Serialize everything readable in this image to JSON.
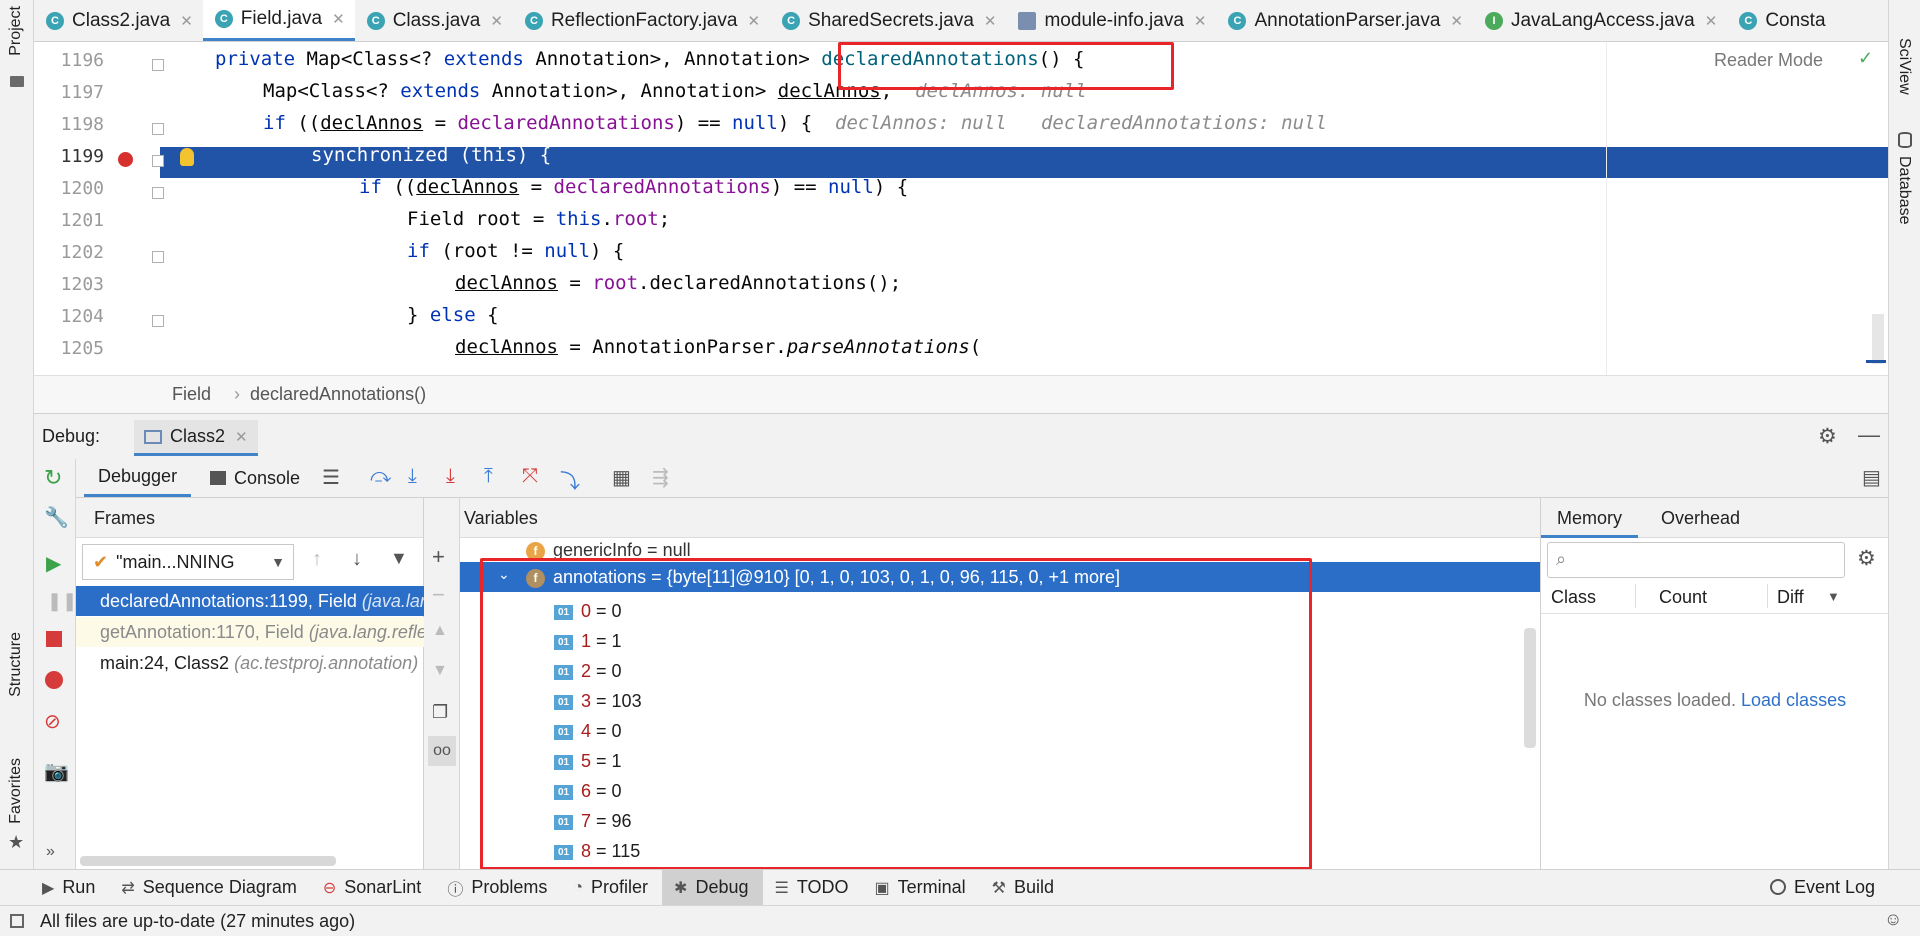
{
  "tabs": [
    {
      "label": "Class2.java",
      "icon": "class-icon",
      "active": false
    },
    {
      "label": "Field.java",
      "icon": "class-icon",
      "active": true
    },
    {
      "label": "Class.java",
      "icon": "class-icon",
      "active": false
    },
    {
      "label": "ReflectionFactory.java",
      "icon": "class-icon",
      "active": false
    },
    {
      "label": "SharedSecrets.java",
      "icon": "class-icon",
      "active": false
    },
    {
      "label": "module-info.java",
      "icon": "module-icon",
      "active": false
    },
    {
      "label": "AnnotationParser.java",
      "icon": "class-icon",
      "active": false
    },
    {
      "label": "JavaLangAccess.java",
      "icon": "interface-icon",
      "active": false
    },
    {
      "label": "Consta",
      "icon": "class-icon",
      "active": false
    }
  ],
  "side_left": {
    "project": "Project",
    "structure": "Structure",
    "favorites": "Favorites"
  },
  "side_right": {
    "sciview": "SciView",
    "database": "Database"
  },
  "editor": {
    "reader_mode": "Reader Mode",
    "line_numbers": [
      "1196",
      "1197",
      "1198",
      "1199",
      "1200",
      "1201",
      "1202",
      "1203",
      "1204",
      "1205"
    ],
    "hints": {
      "l1197": "declAnnos: null",
      "l1198a": "declAnnos: null",
      "l1198b": "declaredAnnotations: null"
    }
  },
  "breadcrumb": {
    "item1": "Field",
    "sep": "›",
    "item2": "declaredAnnotations()"
  },
  "debug": {
    "title": "Debug:",
    "session": "Class2",
    "tab_debugger": "Debugger",
    "tab_console": "Console",
    "frames_header": "Frames",
    "thread_select": "\"main...NNING",
    "frames": [
      {
        "method": "declaredAnnotations:1199, Field",
        "loc": "(java.lang.reflect)",
        "selected": true
      },
      {
        "method": "getAnnotation:1170, Field",
        "loc": "(java.lang.reflect)",
        "selected": false
      },
      {
        "method": "main:24, Class2",
        "loc": "(ac.testproj.annotation)",
        "selected": false
      }
    ],
    "variables_header": "Variables",
    "generic_info": "genericInfo = null",
    "annotations_row": "annotations = {byte[11]@910} [0, 1, 0, 103, 0, 1, 0, 96, 115, 0, +1 more]",
    "array_items": [
      {
        "idx": "0",
        "val": "= 0"
      },
      {
        "idx": "1",
        "val": "= 1"
      },
      {
        "idx": "2",
        "val": "= 0"
      },
      {
        "idx": "3",
        "val": "= 103"
      },
      {
        "idx": "4",
        "val": "= 0"
      },
      {
        "idx": "5",
        "val": "= 1"
      },
      {
        "idx": "6",
        "val": "= 0"
      },
      {
        "idx": "7",
        "val": "= 96"
      },
      {
        "idx": "8",
        "val": "= 115"
      }
    ],
    "memory_tab": "Memory",
    "overhead_tab": "Overhead",
    "col_class": "Class",
    "col_count": "Count",
    "col_diff": "Diff",
    "no_classes": "No classes loaded.",
    "load_classes": "Load classes"
  },
  "bottom_tools": [
    {
      "label": "Run",
      "icon": "play-icon"
    },
    {
      "label": "Sequence Diagram",
      "icon": "sequence-icon"
    },
    {
      "label": "SonarLint",
      "icon": "sonar-icon"
    },
    {
      "label": "Problems",
      "icon": "info-icon"
    },
    {
      "label": "Profiler",
      "icon": "profiler-icon"
    },
    {
      "label": "Debug",
      "icon": "bug-icon",
      "active": true
    },
    {
      "label": "TODO",
      "icon": "list-icon"
    },
    {
      "label": "Terminal",
      "icon": "terminal-icon"
    },
    {
      "label": "Build",
      "icon": "hammer-icon"
    }
  ],
  "event_log": "Event Log",
  "status": "All files are up-to-date (27 minutes ago)",
  "colors": {
    "accent": "#2154a6",
    "highlight_box": "#e8262a",
    "selection": "#2b6ec7"
  }
}
